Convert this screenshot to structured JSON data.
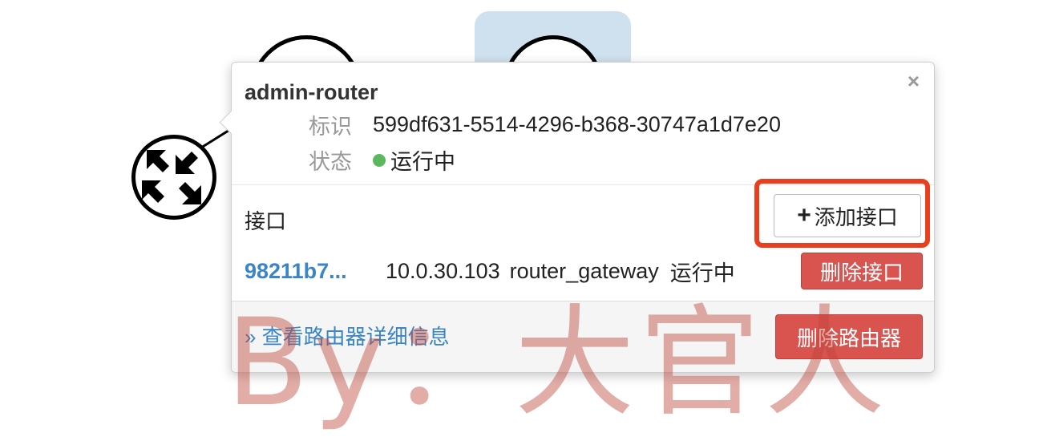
{
  "popover": {
    "close_label": "×",
    "router_name": "admin-router",
    "id_label": "标识",
    "id_value": "599df631-5514-4296-b368-30747a1d7e20",
    "status_label": "状态",
    "status_value": "运行中",
    "interfaces_title": "接口",
    "add_interface_label": "添加接口",
    "interfaces": [
      {
        "id": "98211b7...",
        "ip": "10.0.30.103",
        "name": "router_gateway",
        "status": "运行中",
        "delete_label": "删除接口"
      }
    ],
    "view_details_link": "» 查看路由器详细信息",
    "delete_router_label": "删除路由器"
  },
  "watermark": "By：大官人",
  "colors": {
    "accent_link": "#3a85c6",
    "danger": "#d9534f",
    "status_ok": "#5cb85c",
    "highlight": "#e8401e"
  }
}
